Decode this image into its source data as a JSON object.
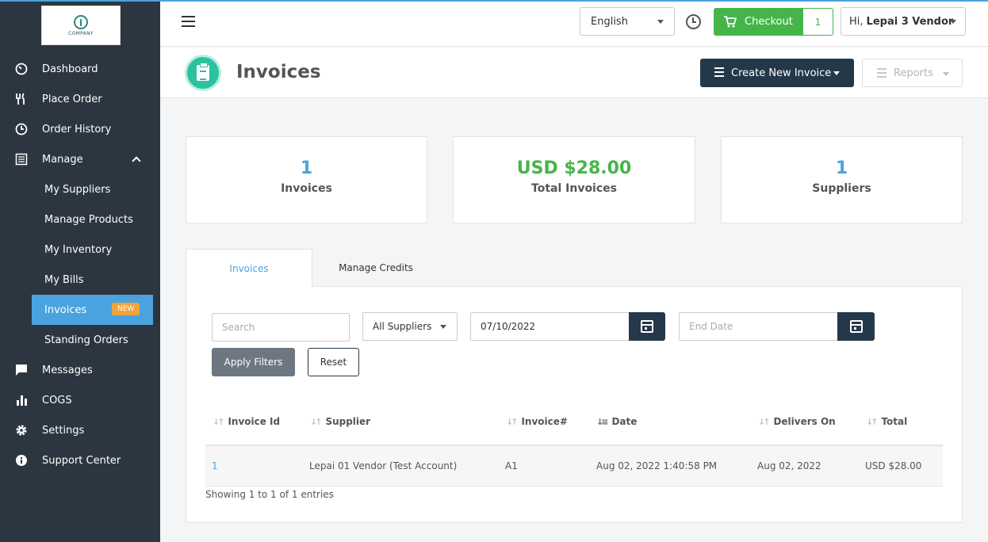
{
  "sidebar": {
    "logo_text": "COMPANY",
    "items": [
      {
        "label": "Dashboard",
        "icon": "dashboard-icon"
      },
      {
        "label": "Place Order",
        "icon": "utensils-icon"
      },
      {
        "label": "Order History",
        "icon": "history-icon"
      },
      {
        "label": "Manage",
        "icon": "list-icon"
      },
      {
        "label": "My Suppliers"
      },
      {
        "label": "Manage Products"
      },
      {
        "label": "My Inventory"
      },
      {
        "label": "My Bills"
      },
      {
        "label": "Invoices",
        "badge": "NEW"
      },
      {
        "label": "Standing Orders"
      },
      {
        "label": "Messages",
        "icon": "chat-icon"
      },
      {
        "label": "COGS",
        "icon": "bar-chart-icon"
      },
      {
        "label": "Settings",
        "icon": "gear-icon"
      },
      {
        "label": "Support Center",
        "icon": "info-icon"
      }
    ]
  },
  "topbar": {
    "language": "English",
    "checkout_label": "Checkout",
    "checkout_count": "1",
    "greeting": "Hi,",
    "user_name": "Lepai 3 Vendor"
  },
  "header": {
    "title": "Invoices",
    "create_label": "Create New Invoice",
    "reports_label": "Reports"
  },
  "stats": [
    {
      "value": "1",
      "label": "Invoices"
    },
    {
      "value": "USD $28.00",
      "label": "Total Invoices"
    },
    {
      "value": "1",
      "label": "Suppliers"
    }
  ],
  "tabs": [
    "Invoices",
    "Manage Credits"
  ],
  "filters": {
    "search_placeholder": "Search",
    "supplier_select": "All Suppliers",
    "start_date": "07/10/2022",
    "end_date_placeholder": "End Date",
    "apply_label": "Apply Filters",
    "reset_label": "Reset"
  },
  "table": {
    "columns": [
      "Invoice Id",
      "Supplier",
      "Invoice#",
      "Date",
      "Delivers On",
      "Total"
    ],
    "rows": [
      [
        "1",
        "Lepai 01 Vendor (Test Account)",
        "A1",
        "Aug 02, 2022 1:40:58 PM",
        "Aug 02, 2022",
        "USD $28.00"
      ]
    ],
    "footer": "Showing 1 to 1 of 1 entries"
  },
  "colors": {
    "sidebar_bg": "#2c3640",
    "accent_blue": "#4aa3df",
    "checkout_green": "#45b549",
    "navy_button": "#24384a",
    "badge_orange": "#f0a43a"
  }
}
